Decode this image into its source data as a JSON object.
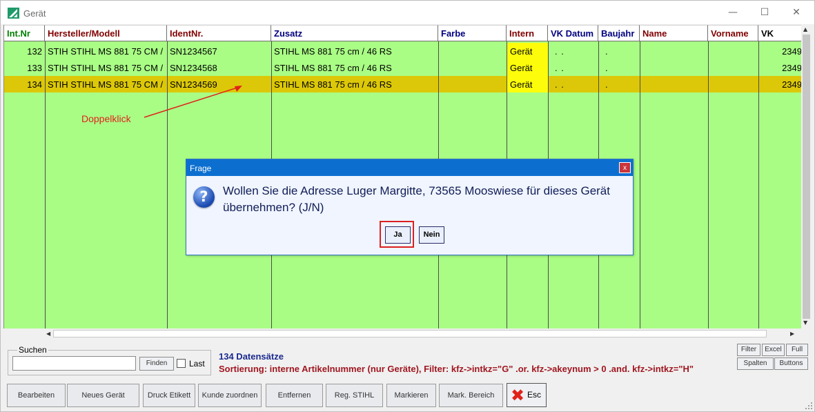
{
  "window": {
    "title": "Gerät",
    "minimize": "—",
    "maximize": "☐",
    "close": "✕"
  },
  "grid": {
    "headers": [
      "Int.Nr",
      "Hersteller/Modell",
      "IdentNr.",
      "Zusatz",
      "Farbe",
      "Intern",
      "VK Datum",
      "Baujahr",
      "Name",
      "Vorname",
      "VK"
    ],
    "rows": [
      {
        "intnr": "132",
        "hersteller": "STIH STIHL MS 881 75 CM /",
        "ident": "SN1234567",
        "zusatz": "STIHL MS 881 75 cm / 46 RS",
        "farbe": "",
        "intern": "Gerät",
        "vkdatum": ". .",
        "baujahr": ".",
        "name": "",
        "vorname": "",
        "vk": "2349"
      },
      {
        "intnr": "133",
        "hersteller": "STIH STIHL MS 881 75 CM /",
        "ident": "SN1234568",
        "zusatz": "STIHL MS 881 75 cm / 46 RS",
        "farbe": "",
        "intern": "Gerät",
        "vkdatum": ". .",
        "baujahr": ".",
        "name": "",
        "vorname": "",
        "vk": "2349"
      },
      {
        "intnr": "134",
        "hersteller": "STIH STIHL MS 881 75 CM /",
        "ident": "SN1234569",
        "zusatz": "STIHL MS 881 75 cm / 46 RS",
        "farbe": "",
        "intern": "Gerät",
        "vkdatum": ". .",
        "baujahr": ".",
        "name": "",
        "vorname": "",
        "vk": "2349",
        "selected": true
      }
    ]
  },
  "annotation": {
    "text": "Doppelklick"
  },
  "dialog": {
    "title": "Frage",
    "close": "x",
    "icon": "question-icon",
    "message": "Wollen Sie die Adresse Luger Margitte, 73565 Mooswiese für dieses Gerät übernehmen? (J/N)",
    "yes": "Ja",
    "no": "Nein"
  },
  "search": {
    "legend": "Suchen",
    "value": "",
    "find_button": "Finden",
    "last_label": "Last"
  },
  "status": {
    "count": "134 Datensätze",
    "sort": "Sortierung: interne Artikelnummer (nur Geräte), Filter: kfz->intkz=\"G\" .or. kfz->akeynum > 0 .and. kfz->intkz=\"H\""
  },
  "side_buttons": {
    "filter": "Filter",
    "excel": "Excel",
    "full": "Full",
    "spalten": "Spalten",
    "buttons": "Buttons"
  },
  "buttons": [
    "Bearbeiten",
    "Neues Gerät",
    "Druck Etikett",
    "Kunde zuordnen",
    "Entfernen",
    "Reg. STIHL",
    "Markieren",
    "Mark. Bereich"
  ],
  "esc": {
    "label": "Esc",
    "icon": "red-x-icon"
  },
  "colors": {
    "grid_bg": "#a9fd85",
    "selected_row": "#dcc808",
    "intern_cell": "#fdfd0b",
    "dialog_title": "#0c6fd0",
    "annotation": "#e0221a"
  }
}
